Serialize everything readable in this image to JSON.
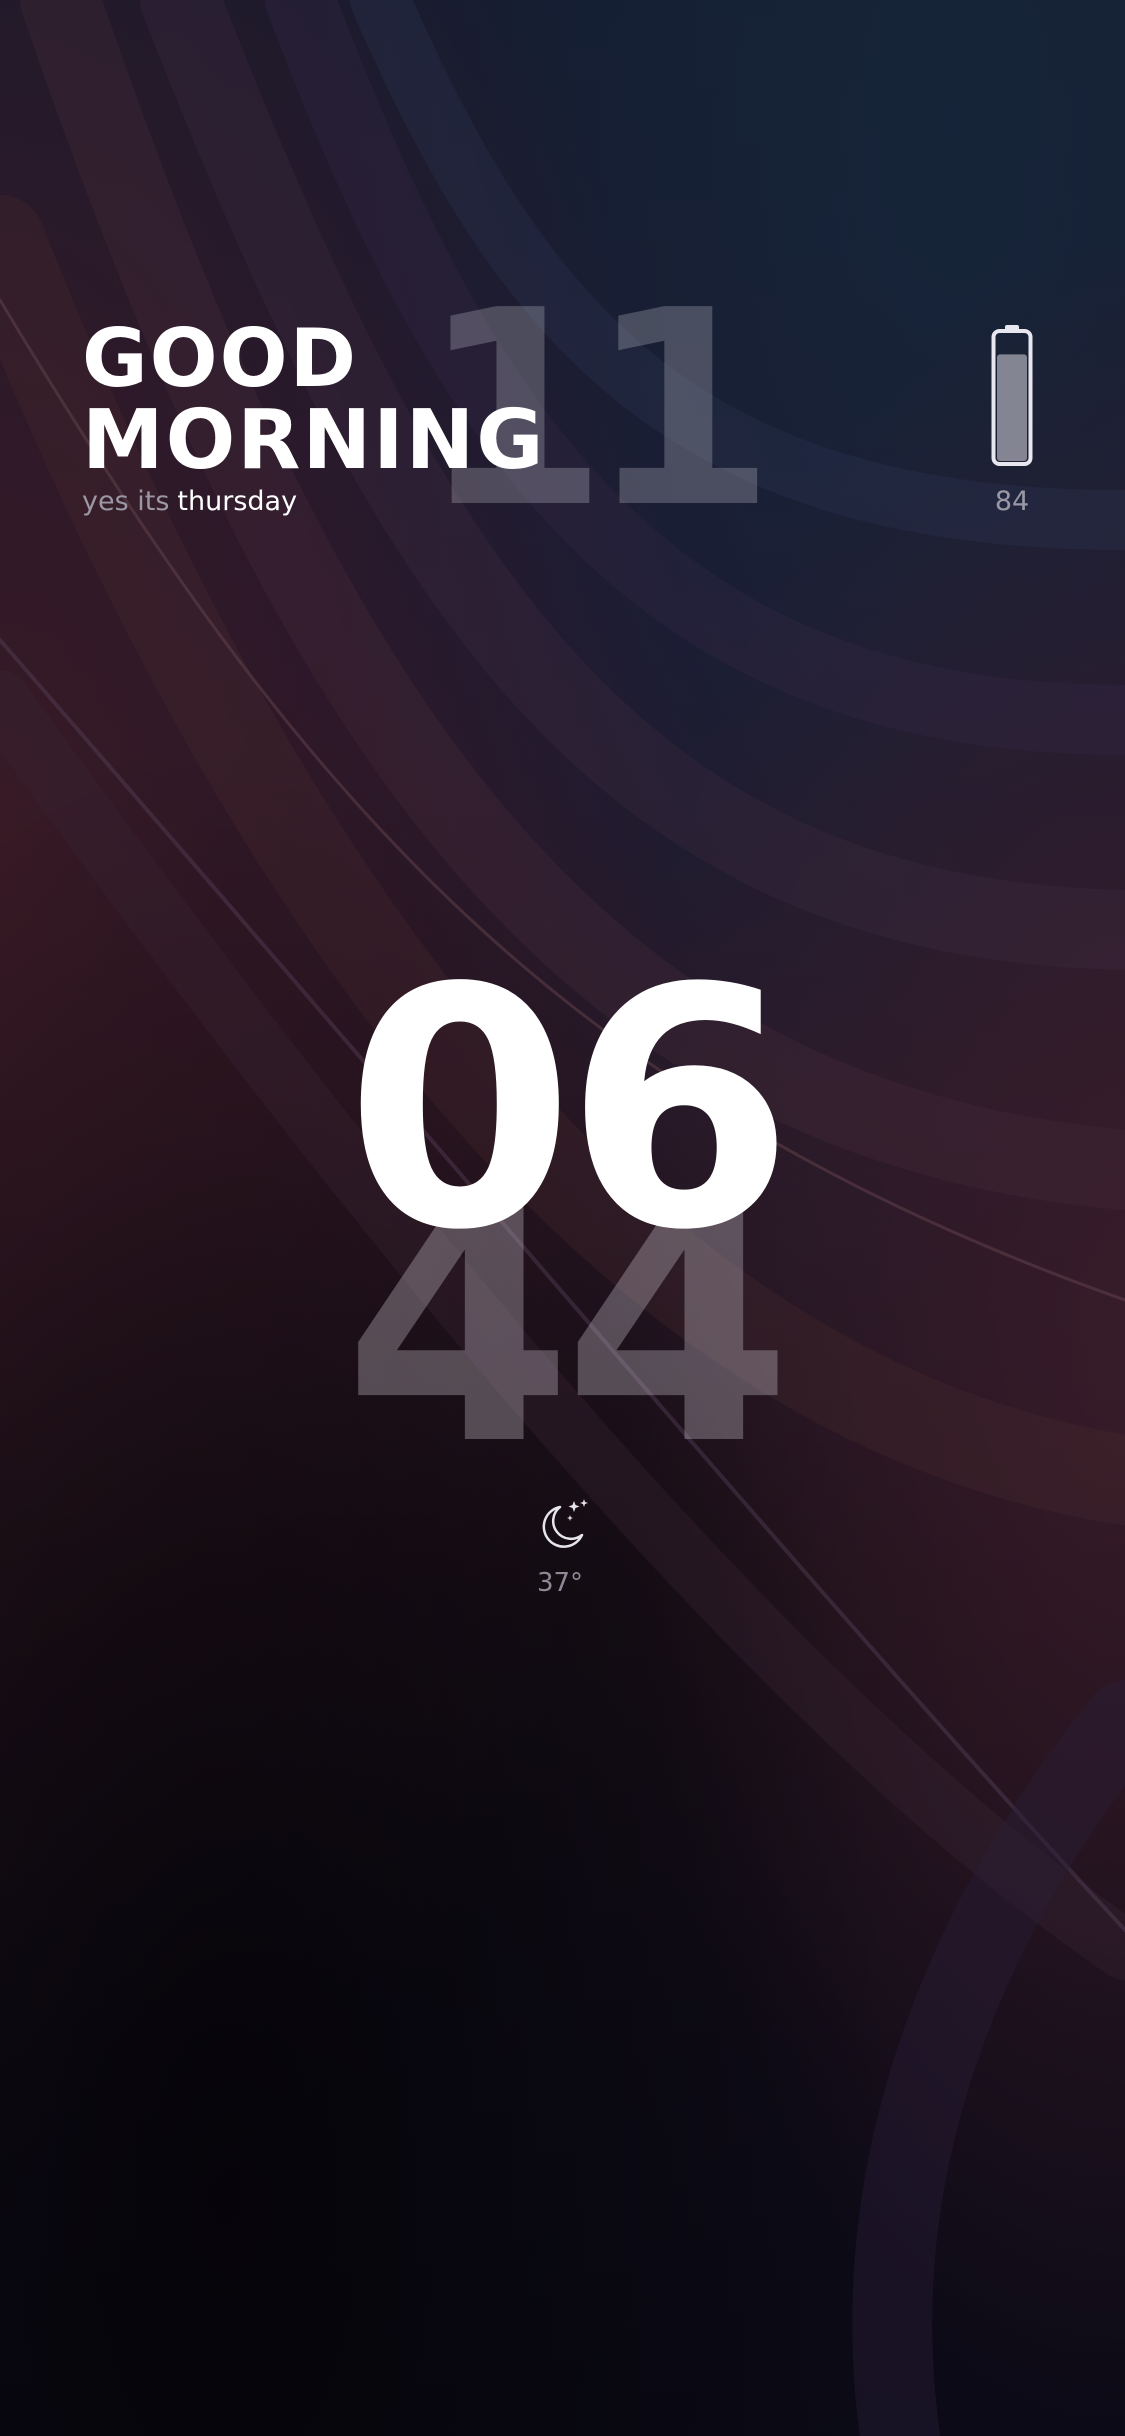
{
  "greeting": {
    "line1": "GOOD",
    "line2": "MORNING",
    "prefix": "yes its",
    "day": "thursday"
  },
  "date": {
    "day_number": "11"
  },
  "battery": {
    "level": 84,
    "label": "84",
    "icon": "battery-icon"
  },
  "clock": {
    "hour": "06",
    "minute": "44"
  },
  "weather": {
    "icon": "moon-stars-icon",
    "temperature": "37°"
  },
  "colors": {
    "text_primary": "#ffffff",
    "text_muted": "#9b97a4",
    "background_dark": "#0a0914"
  }
}
